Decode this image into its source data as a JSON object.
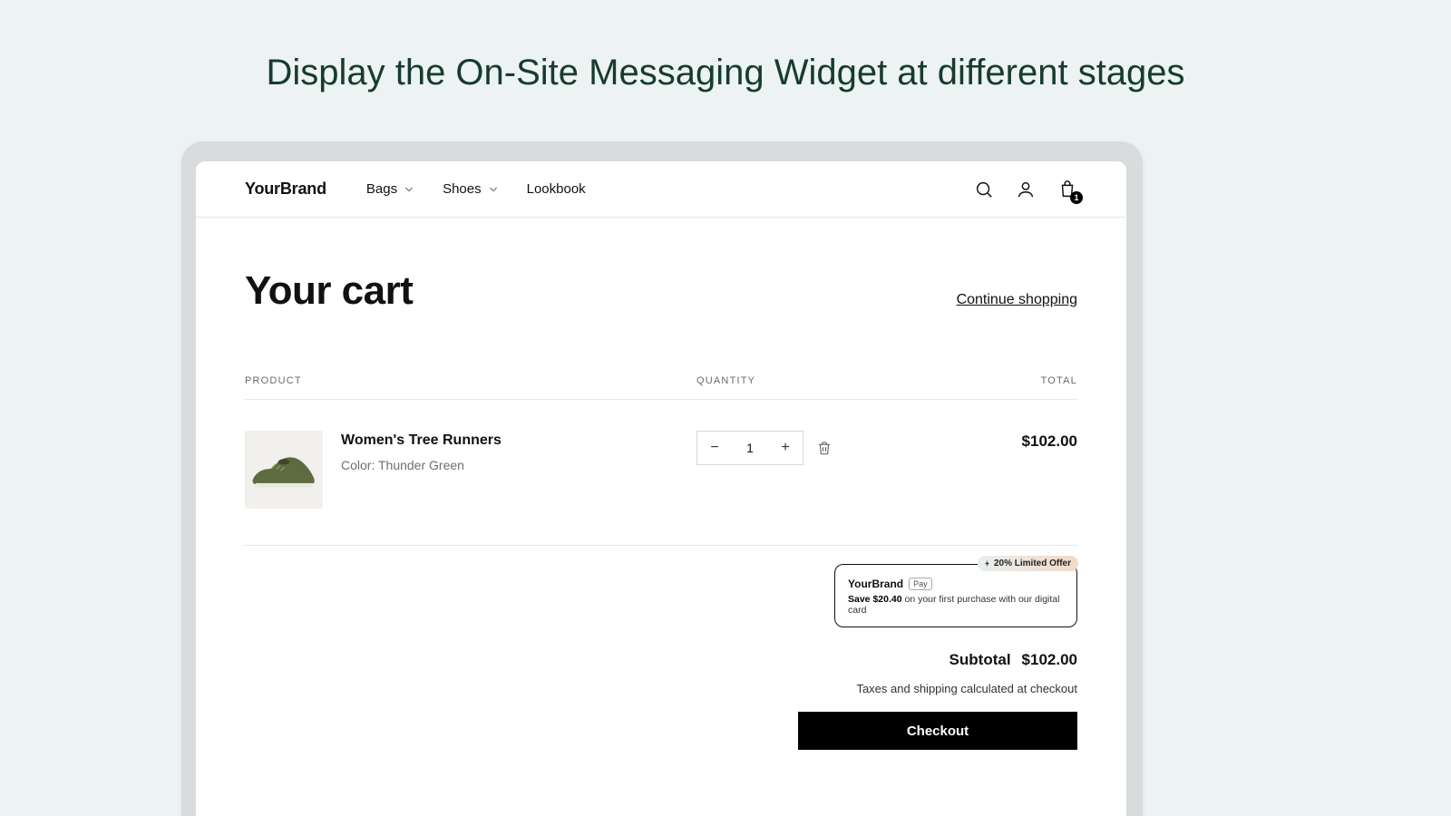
{
  "stage_title": "Display the On-Site Messaging Widget at different stages",
  "brand": "YourBrand",
  "nav": {
    "items": [
      "Bags",
      "Shoes",
      "Lookbook"
    ]
  },
  "cart_badge": "1",
  "cart": {
    "title": "Your cart",
    "continue_label": "Continue shopping",
    "columns": {
      "product": "PRODUCT",
      "quantity": "QUANTITY",
      "total": "TOTAL"
    },
    "item": {
      "name": "Women's Tree Runners",
      "variant": "Color: Thunder Green",
      "quantity": "1",
      "line_total": "$102.00"
    }
  },
  "promo": {
    "tag": "20% Limited Offer",
    "brand": "YourBrand",
    "pay_chip": "Pay",
    "save_bold": "Save $20.40",
    "save_rest": " on your first purchase with our digital card"
  },
  "summary": {
    "subtotal_label": "Subtotal",
    "subtotal_value": "$102.00",
    "tax_note": "Taxes and shipping calculated at checkout",
    "checkout_label": "Checkout"
  }
}
